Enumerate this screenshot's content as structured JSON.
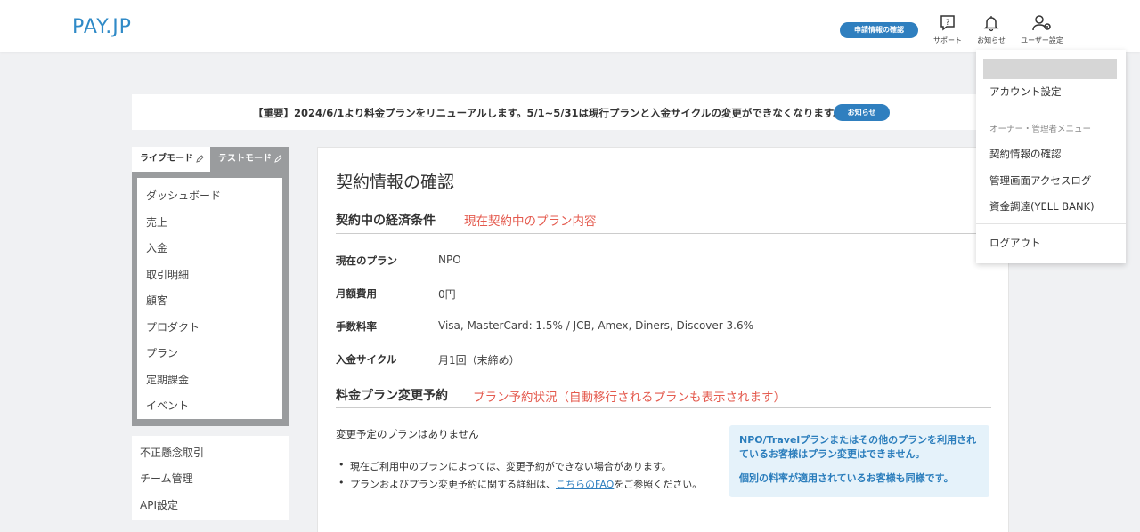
{
  "header": {
    "logo_main": "PAY",
    "logo_dot": ".",
    "logo_suffix": "JP",
    "contract_button": "申請情報の確認",
    "support_label": "サポート",
    "notice_label": "お知らせ",
    "user_settings_label": "ユーザー設定"
  },
  "notice_banner": {
    "text": "【重要】2024/6/1より料金プランをリニューアルします。5/1~5/31は現行プランと入金サイクルの変更ができなくなります。",
    "button": "お知らせ"
  },
  "sidebar": {
    "live_mode": "ライブモード",
    "test_mode": "テストモード",
    "items": [
      "ダッシュボード",
      "売上",
      "入金",
      "取引明細",
      "顧客",
      "プロダクト",
      "プラン",
      "定期課金",
      "イベント"
    ],
    "lower_items": [
      "不正懸念取引",
      "チーム管理",
      "API設定"
    ]
  },
  "main": {
    "title": "契約情報の確認",
    "section1": {
      "title": "契約中の経済条件",
      "annotation": "現在契約中のプラン内容",
      "rows": [
        {
          "label": "現在のプラン",
          "value": "NPO"
        },
        {
          "label": "月額費用",
          "value": "0円"
        },
        {
          "label": "手数料率",
          "value": "Visa, MasterCard: 1.5% / JCB, Amex, Diners, Discover 3.6%"
        },
        {
          "label": "入金サイクル",
          "value": "月1回（末締め）"
        }
      ]
    },
    "section2": {
      "title": "料金プラン変更予約",
      "annotation": "プラン予約状況（自動移行されるプランも表示されます）",
      "no_plan": "変更予定のプランはありません",
      "bullet1": "現在ご利用中のプランによっては、変更予約ができない場合があります。",
      "bullet2_pre": "プランおよびプラン変更予約に関する詳細は、",
      "bullet2_link": "こちらのFAQ",
      "bullet2_post": "をご参照ください。"
    },
    "infobox": {
      "line1": "NPO/Travelプランまたはその他のプランを利用されているお客様はプラン変更はできません。",
      "line2": "個別の料率が適用されているお客様も同様です。"
    }
  },
  "dropdown": {
    "account_settings": "アカウント設定",
    "admin_heading": "オーナー・管理者メニュー",
    "contract_info": "契約情報の確認",
    "access_log": "管理画面アクセスログ",
    "yell_bank": "資金調達(YELL BANK)",
    "logout": "ログアウト"
  },
  "colors": {
    "brand": "#2f8ac7",
    "button": "#2f7fbf",
    "annotation": "#e45a4e",
    "info_bg": "#e5f2fa"
  }
}
